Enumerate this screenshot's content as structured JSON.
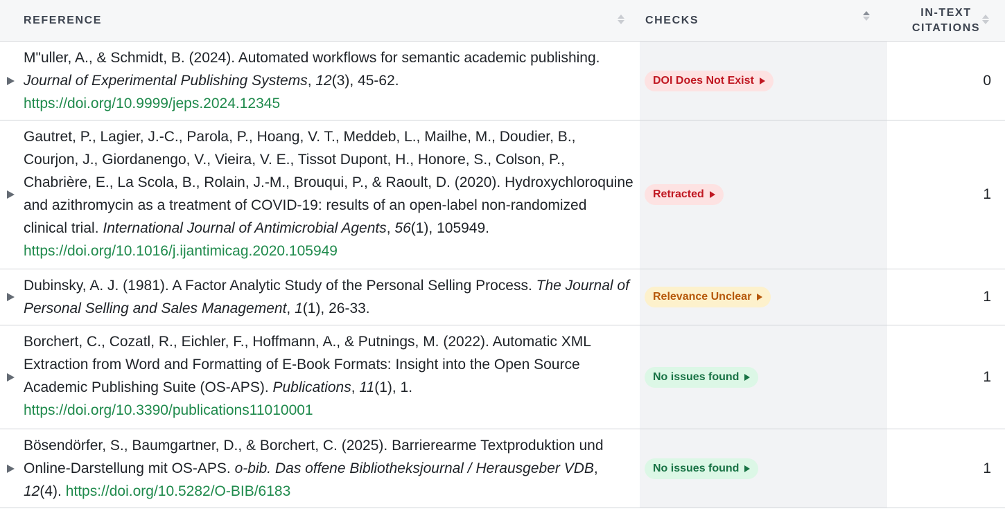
{
  "header": {
    "reference": "REFERENCE",
    "checks": "CHECKS",
    "citations_line1": "IN-TEXT",
    "citations_line2": "CITATIONS"
  },
  "colors": {
    "header_bg": "#f6f7f8",
    "checks_col_bg": "#f2f3f5",
    "doi_link": "#1f8a4c",
    "badge_red": "#c01822",
    "badge_amber": "#b6580b",
    "badge_green": "#177244"
  },
  "rows": [
    {
      "p1": "M\"uller, A., & Schmidt, B. (2024). Automated workflows for semantic academic publishing. ",
      "i1": "Journal of Experimental Publishing Systems",
      "p2": ", ",
      "i2": "12",
      "p3": "(3), 45-62. ",
      "doi": "https://doi.org/10.9999/jeps.2024.12345",
      "badge": "DOI Does Not Exist",
      "badge_style": "red",
      "citations": "0"
    },
    {
      "p1": "Gautret, P., Lagier, J.-C., Parola, P., Hoang, V. T., Meddeb, L., Mailhe, M., Doudier, B., Courjon, J., Giordanengo, V., Vieira, V. E., Tissot Dupont, H., Honore, S., Colson, P., Chabrière, E., La Scola, B., Rolain, J.-M., Brouqui, P., & Raoult, D. (2020). Hydroxychloroquine and azithromycin as a treatment of COVID-19: results of an open-label non-randomized clinical trial. ",
      "i1": "International Journal of Antimicrobial Agents",
      "p2": ", ",
      "i2": "56",
      "p3": "(1), 105949. ",
      "doi": "https://doi.org/10.1016/j.ijantimicag.2020.105949",
      "badge": "Retracted",
      "badge_style": "red",
      "citations": "1"
    },
    {
      "p1": "Dubinsky, A. J. (1981). A Factor Analytic Study of the Personal Selling Process. ",
      "i1": "The Journal of Personal Selling and Sales Management",
      "p2": ", ",
      "i2": "1",
      "p3": "(1), 26-33.",
      "doi": "",
      "badge": "Relevance Unclear",
      "badge_style": "amber",
      "citations": "1"
    },
    {
      "p1": "Borchert, C., Cozatl, R., Eichler, F., Hoffmann, A., & Putnings, M. (2022). Automatic XML Extraction from Word and Formatting of E-Book Formats: Insight into the Open Source Academic Publishing Suite (OS-APS). ",
      "i1": "Publications",
      "p2": ", ",
      "i2": "11",
      "p3": "(1), 1. ",
      "doi": "https://doi.org/10.3390/publications11010001",
      "badge": "No issues found",
      "badge_style": "green",
      "citations": "1"
    },
    {
      "p1": "Bösendörfer, S., Baumgartner, D., & Borchert, C. (2025). Barrierearme Textproduktion und Online-Darstellung mit OS-APS. ",
      "i1": "o-bib. Das offene Bibliotheksjournal / Herausgeber VDB",
      "p2": ", ",
      "i2": "12",
      "p3": "(4). ",
      "doi": "https://doi.org/10.5282/O-BIB/6183",
      "badge": "No issues found",
      "badge_style": "green",
      "citations": "1"
    }
  ]
}
